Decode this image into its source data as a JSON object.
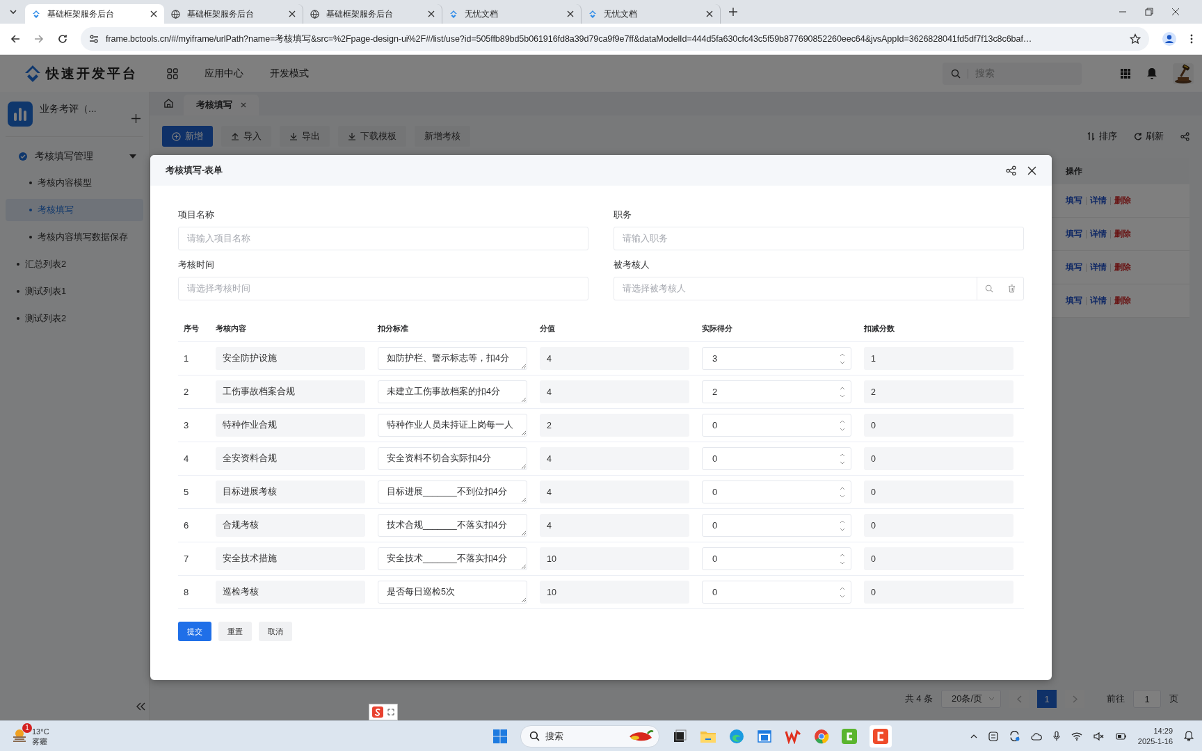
{
  "browser": {
    "tabs": [
      {
        "title": "基础框架服务后台",
        "selected": true,
        "kind": "app"
      },
      {
        "title": "基础框架服务后台",
        "selected": false,
        "kind": "globe"
      },
      {
        "title": "基础框架服务后台",
        "selected": false,
        "kind": "globe"
      },
      {
        "title": "无忧文档",
        "selected": false,
        "kind": "app"
      },
      {
        "title": "无忧文档",
        "selected": false,
        "kind": "app"
      }
    ],
    "url": "frame.bctools.cn/#/myiframe/urlPath?name=考核填写&src=%2Fpage-design-ui%2F#/list/use?id=505ffb89bd5b061916fd8a39d79ca9f9e7ff&dataModelId=444d5fa630cfc43c5f59b877690852260eec64&jvsAppId=3626828041fd5df7f13c8c6baf…"
  },
  "header": {
    "logo": "快速开发平台",
    "nav": [
      "应用中心",
      "开发模式"
    ],
    "search_placeholder": "搜索"
  },
  "sidebar": {
    "app_name": "业务考评（...",
    "menu": [
      {
        "label": "考核填写管理",
        "selected": false,
        "expanded": true,
        "children": [
          {
            "label": "考核内容模型",
            "selected": false
          },
          {
            "label": "考核填写",
            "selected": true
          },
          {
            "label": "考核内容填写数据保存",
            "selected": false
          }
        ]
      },
      {
        "label": "汇总列表2",
        "selected": false
      },
      {
        "label": "测试列表1",
        "selected": false
      },
      {
        "label": "测试列表2",
        "selected": false
      }
    ]
  },
  "page_tabs": [
    {
      "label": "考核填写",
      "selected": true
    }
  ],
  "toolbar": {
    "buttons": [
      {
        "label": "新增",
        "kind": "primary"
      },
      {
        "label": "导入",
        "kind": "upload"
      },
      {
        "label": "导出",
        "kind": "download"
      },
      {
        "label": "下载模板",
        "kind": "download"
      },
      {
        "label": "新增考核",
        "kind": "plain"
      }
    ],
    "right": [
      {
        "label": "排序",
        "kind": "sort"
      },
      {
        "label": "刷新",
        "kind": "refresh"
      }
    ]
  },
  "list": {
    "column": "操作",
    "rows": [
      {
        "actions": [
          {
            "label": "填写",
            "kind": "link"
          },
          {
            "label": "详情",
            "kind": "link"
          },
          {
            "label": "删除",
            "kind": "danger"
          }
        ]
      },
      {
        "actions": [
          {
            "label": "填写",
            "kind": "link"
          },
          {
            "label": "详情",
            "kind": "link"
          },
          {
            "label": "删除",
            "kind": "danger"
          }
        ]
      },
      {
        "actions": [
          {
            "label": "填写",
            "kind": "link"
          },
          {
            "label": "详情",
            "kind": "link"
          },
          {
            "label": "删除",
            "kind": "danger"
          }
        ]
      },
      {
        "actions": [
          {
            "label": "填写",
            "kind": "link"
          },
          {
            "label": "详情",
            "kind": "link"
          },
          {
            "label": "删除",
            "kind": "danger"
          }
        ]
      }
    ]
  },
  "pagination": {
    "total": "共 4 条",
    "page_size": "20条/页",
    "pages": [
      {
        "label": "1",
        "selected": true
      }
    ],
    "goto_label": "前往",
    "goto_value": "1",
    "goto_suffix": "页"
  },
  "modal": {
    "title": "考核填写-表单",
    "fields": [
      {
        "label": "项目名称",
        "placeholder": "请输入项目名称",
        "kind": "text"
      },
      {
        "label": "职务",
        "placeholder": "请输入职务",
        "kind": "text"
      },
      {
        "label": "考核时间",
        "placeholder": "请选择考核时间",
        "kind": "text"
      },
      {
        "label": "被考核人",
        "placeholder": "请选择被考核人",
        "kind": "picker"
      }
    ],
    "table": {
      "columns": [
        "序号",
        "考核内容",
        "扣分标准",
        "分值",
        "实际得分",
        "扣减分数"
      ],
      "rows": [
        {
          "index": "1",
          "content": "安全防护设施",
          "standard": "如防护栏、警示标志等，扣4分",
          "score": "4",
          "actual": "3",
          "deduction": "1"
        },
        {
          "index": "2",
          "content": "工伤事故档案合规",
          "standard": "未建立工伤事故档案的扣4分",
          "score": "4",
          "actual": "2",
          "deduction": "2"
        },
        {
          "index": "3",
          "content": "特种作业合规",
          "standard": "特种作业人员未持证上岗每一人",
          "score": "2",
          "actual": "0",
          "deduction": "0"
        },
        {
          "index": "4",
          "content": "全安资料合规",
          "standard": "安全资料不切合实际扣4分",
          "score": "4",
          "actual": "0",
          "deduction": "0"
        },
        {
          "index": "5",
          "content": "目标进展考核",
          "standard": "目标进展_______不到位扣4分",
          "score": "4",
          "actual": "0",
          "deduction": "0"
        },
        {
          "index": "6",
          "content": "合规考核",
          "standard": "技术合规_______不落实扣4分",
          "score": "4",
          "actual": "0",
          "deduction": "0"
        },
        {
          "index": "7",
          "content": "安全技术措施",
          "standard": "安全技术_______不落实扣4分",
          "score": "10",
          "actual": "0",
          "deduction": "0"
        },
        {
          "index": "8",
          "content": "巡检考核",
          "standard": "是否每日巡检5次",
          "score": "10",
          "actual": "0",
          "deduction": "0"
        }
      ]
    },
    "buttons": [
      {
        "label": "提交",
        "kind": "primary"
      },
      {
        "label": "重置",
        "kind": "plain"
      },
      {
        "label": "取消",
        "kind": "plain"
      }
    ]
  },
  "taskbar": {
    "temperature": "13°C",
    "weather": "雾霾",
    "badge": "1",
    "search_placeholder": "搜索",
    "time": "14:29",
    "date": "2025-1-16"
  }
}
